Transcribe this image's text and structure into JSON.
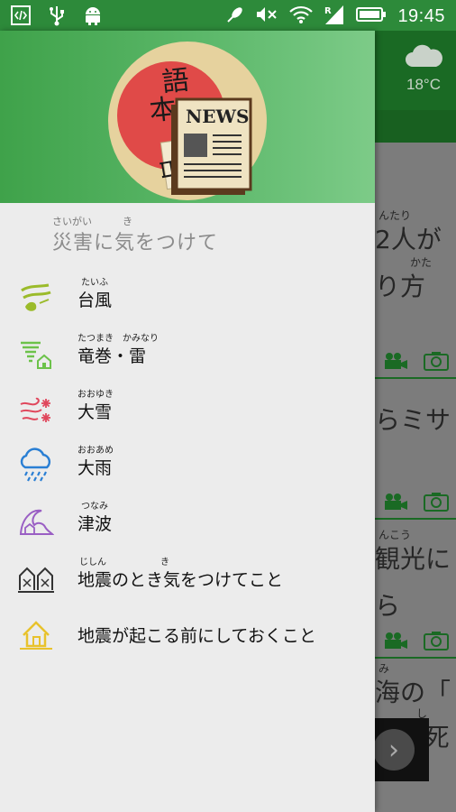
{
  "status_bar": {
    "time": "19:45",
    "left_icons": [
      "dev-tools-icon",
      "usb-icon",
      "android-icon"
    ],
    "right_icons": [
      "satellite-icon",
      "mute-icon",
      "wifi-icon",
      "signal-roaming-icon",
      "battery-icon"
    ]
  },
  "background": {
    "weather_temp": "18°C",
    "texts": [
      {
        "ruby": "んたり",
        "text": "2人が"
      },
      {
        "ruby": "かた",
        "text": "り方"
      },
      {
        "ruby": "",
        "text": "らミサ"
      },
      {
        "ruby": "んこう",
        "text": "観光に"
      },
      {
        "ruby": "",
        "text": "ら"
      },
      {
        "ruby": "み",
        "text": "海の「"
      },
      {
        "ruby": "し",
        "text": "って死"
      }
    ]
  },
  "drawer": {
    "logo_badge": "NEWS",
    "logo_kanji": "日本語",
    "section": {
      "ruby_left": "さいがい",
      "ruby_right": "き",
      "title": "災害に気をつけて"
    },
    "items": [
      {
        "ruby": "たいふ",
        "label": "台風",
        "icon": "typhoon-icon",
        "color": "#9bbb2a"
      },
      {
        "ruby": "たつまき　かみなり",
        "label": "竜巻・雷",
        "icon": "tornado-icon",
        "color": "#6cc24a"
      },
      {
        "ruby": "おおゆき",
        "label": "大雪",
        "icon": "snowstorm-icon",
        "color": "#e0475c"
      },
      {
        "ruby": "おおあめ",
        "label": "大雨",
        "icon": "heavy-rain-icon",
        "color": "#2a7fd4"
      },
      {
        "ruby": "つなみ",
        "label": "津波",
        "icon": "tsunami-icon",
        "color": "#9a5fc4"
      },
      {
        "ruby": "じしん　　　　　　き",
        "label": "地震のとき気をつけてこと",
        "icon": "earthquake-icon",
        "color": "#333333"
      },
      {
        "ruby": "",
        "label": "地震が起こる前にしておくこと",
        "icon": "house-prepare-icon",
        "color": "#e8c22c"
      }
    ]
  }
}
